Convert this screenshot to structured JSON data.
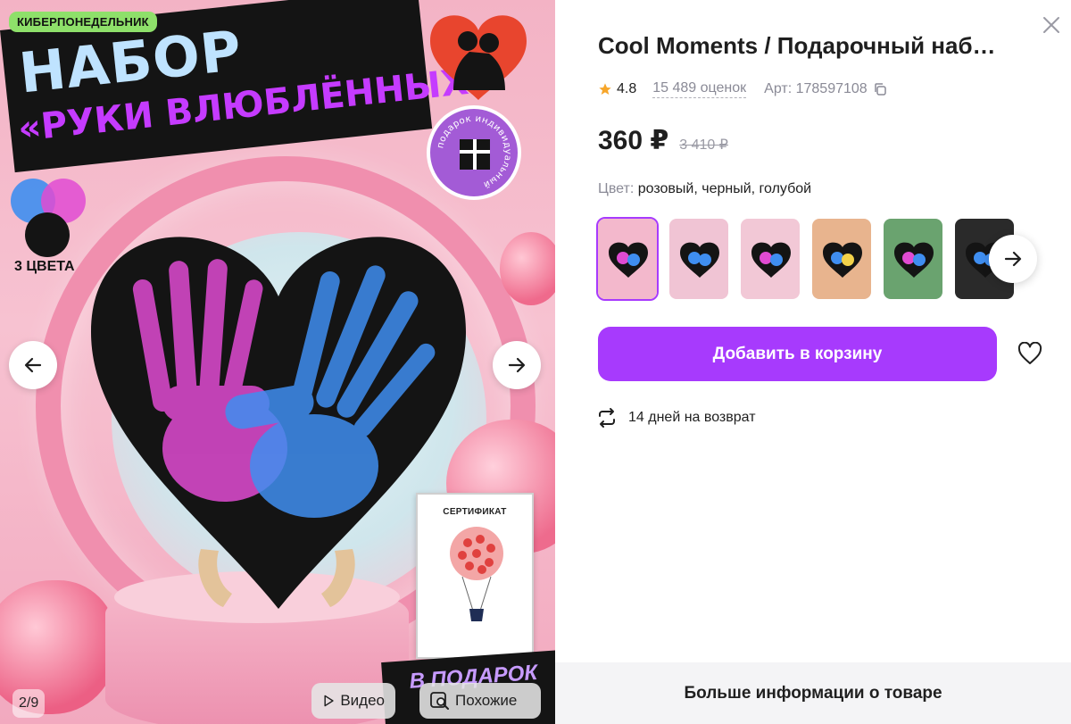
{
  "gallery": {
    "promo_badge": "КИБЕРПОНЕДЕЛЬНИК",
    "headline_line1": "НАБОР",
    "headline_line2": "«РУКИ ВЛЮБЛЁННЫХ»",
    "gift_badge_text": "подарок индивидуальный",
    "colors_label": "3 ЦВЕТА",
    "certificate_title": "СЕРТИФИКАТ",
    "bottom_promo": "В ПОДАРОК",
    "counter": "2/9",
    "video_label": "Видео",
    "similar_label": "Похожие",
    "colors": {
      "pink": "#e04bd2",
      "blue": "#3f8ef0",
      "black": "#141414",
      "purple": "#c53bff"
    }
  },
  "product": {
    "title": "Cool Moments / Подарочный наб…",
    "rating": "4.8",
    "reviews": "15 489 оценок",
    "article": "Арт: 178597108",
    "price": "360 ₽",
    "old_price": "3 410 ₽",
    "color_label": "Цвет:",
    "color_value": "розовый, черный, голубой",
    "add_to_cart": "Добавить в корзину",
    "return_policy": "14 дней на возврат",
    "more_info": "Больше информации о товаре",
    "accent": "#a73afd"
  },
  "thumbnails": [
    {
      "bg": "#f3b8cc",
      "active": true
    },
    {
      "bg": "#f0c4d4",
      "active": false
    },
    {
      "bg": "#f2c8d6",
      "active": false
    },
    {
      "bg": "#e8b48e",
      "active": false
    },
    {
      "bg": "#6aa36f",
      "active": false
    },
    {
      "bg": "#2a2a2a",
      "active": false
    }
  ]
}
